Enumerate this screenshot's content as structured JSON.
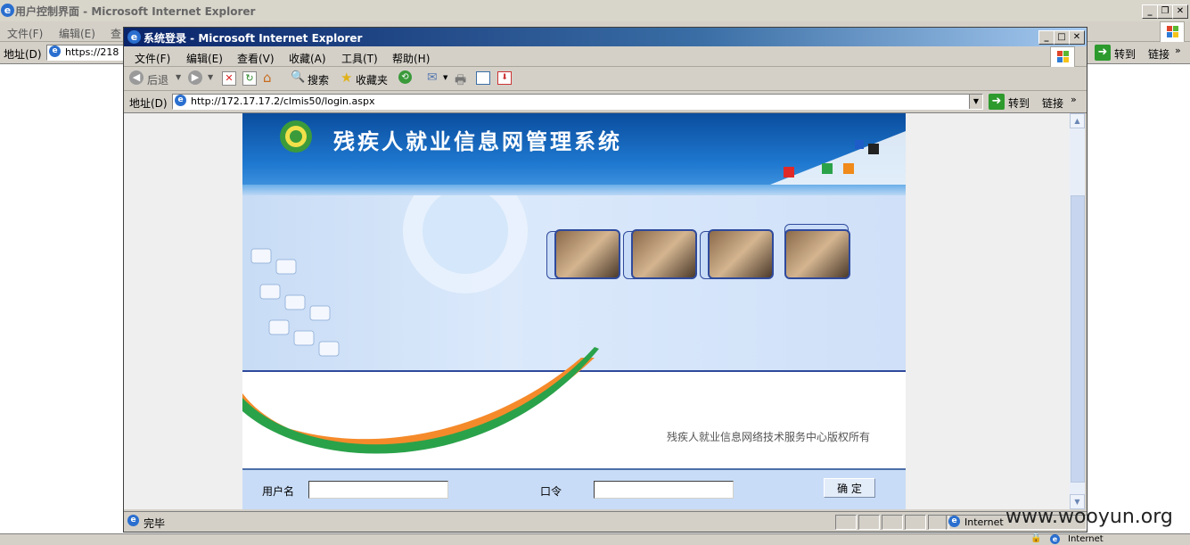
{
  "back_window": {
    "title": "用户控制界面 - Microsoft Internet Explorer",
    "menu": [
      "文件(F)",
      "编辑(E)",
      "查"
    ],
    "address_label": "地址(D)",
    "address_value": "https://218",
    "go_label": "转到",
    "links_label": "链接",
    "status_zone": "Internet"
  },
  "front_window": {
    "title": "系统登录 - Microsoft Internet Explorer",
    "menu": [
      "文件(F)",
      "编辑(E)",
      "查看(V)",
      "收藏(A)",
      "工具(T)",
      "帮助(H)"
    ],
    "toolbar": {
      "back_label": "后退",
      "search_label": "搜索",
      "favorites_label": "收藏夹"
    },
    "address_label": "地址(D)",
    "address_value": "http://172.17.17.2/clmis50/login.aspx",
    "go_label": "转到",
    "links_label": "链接",
    "status_text": "完毕",
    "status_zone": "Internet"
  },
  "login_page": {
    "system_title": "残疾人就业信息网管理系统",
    "copyright": "残疾人就业信息网络技术服务中心版权所有",
    "username_label": "用户名",
    "password_label": "口令",
    "submit_label": "确 定",
    "username_value": "",
    "password_value": ""
  },
  "watermark": "www.wooyun.org",
  "colors": {
    "title_active_start": "#0a246a",
    "title_active_end": "#a6caf0",
    "banner_blue": "#1e78cf",
    "swoosh_orange": "#f58a2a",
    "swoosh_green": "#2aa24a",
    "form_bg": "#c9dcf7"
  }
}
